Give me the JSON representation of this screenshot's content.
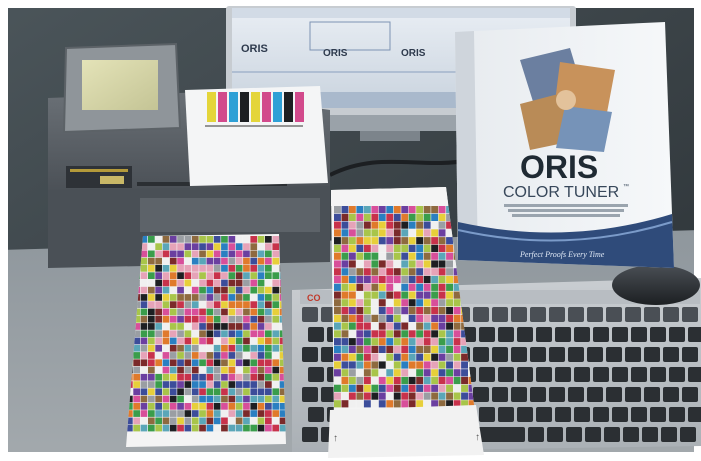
{
  "monitor": {
    "logos": [
      "ORIS",
      "ORIS",
      "ORIS"
    ]
  },
  "booklet": {
    "brand": "ORIS",
    "product": "COLOR TUNER",
    "trademark": "™",
    "slogan": "Perfect Proofs Every Time"
  },
  "keyboard": {
    "brand_fragment": "CO"
  },
  "colors": {
    "backdrop": "#3a4348",
    "desk": "#8d949a",
    "booklet_brand": "#1f2a33",
    "booklet_slogan": "#3c5a8a",
    "keyboard_brand": "#c0392b"
  }
}
